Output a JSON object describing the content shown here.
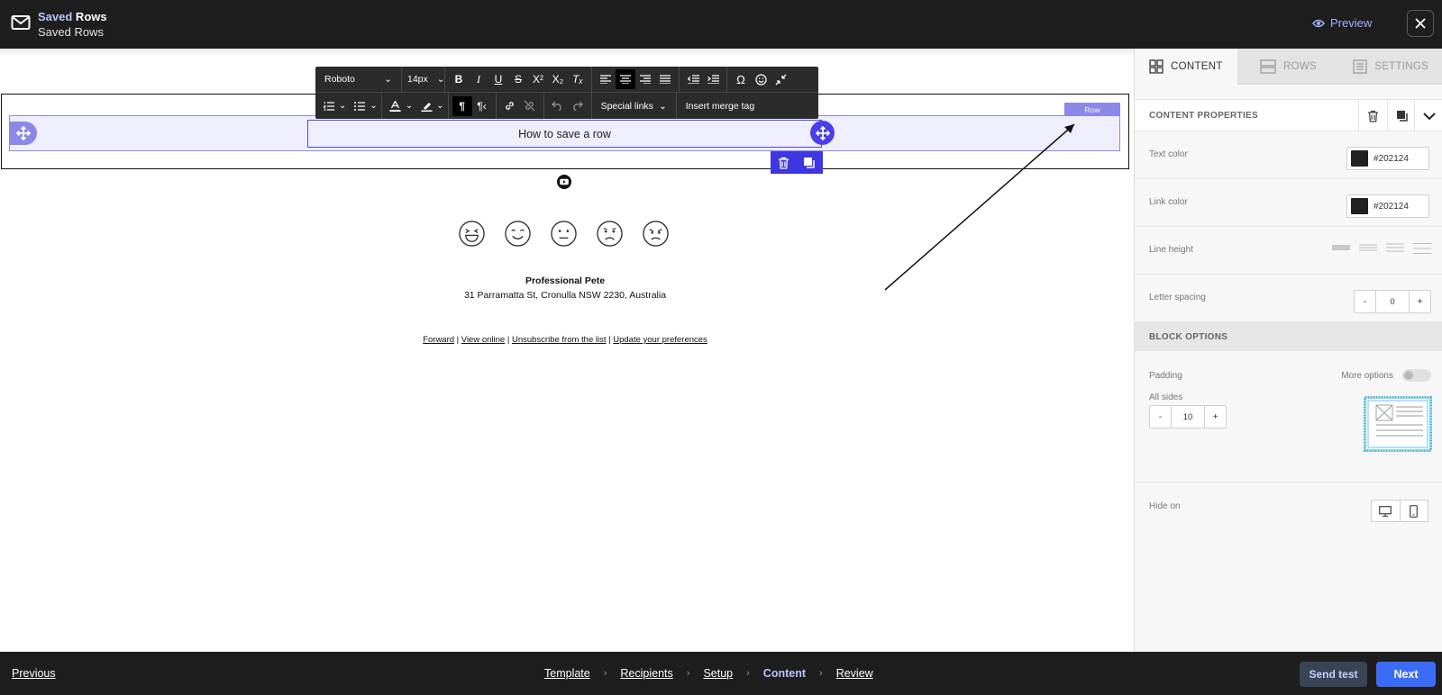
{
  "header": {
    "title_highlight": "Saved",
    "title_rest": " Rows",
    "subtitle": "Saved Rows",
    "preview_label": "Preview"
  },
  "editor": {
    "font_family": "Roboto",
    "font_size": "14px",
    "special_links_label": "Special links",
    "merge_tag_label": "Insert merge tag",
    "row_tag": "Row",
    "text_block": "How to save a row"
  },
  "email": {
    "contact_name": "Professional Pete",
    "contact_address": "31 Parramatta St, Cronulla NSW 2230, Australia",
    "footer_links": [
      "Forward",
      "View online",
      "Unsubscribe from the list",
      "Update your preferences"
    ],
    "footer_sep": " | "
  },
  "panel": {
    "tabs": [
      {
        "label": "CONTENT",
        "icon": "content-grid-icon",
        "active": true
      },
      {
        "label": "ROWS",
        "icon": "rows-icon",
        "active": false
      },
      {
        "label": "SETTINGS",
        "icon": "settings-list-icon",
        "active": false
      }
    ],
    "content_properties_title": "CONTENT PROPERTIES",
    "text_color_label": "Text color",
    "text_color_value": "#202124",
    "link_color_label": "Link color",
    "link_color_value": "#202124",
    "line_height_label": "Line height",
    "letter_spacing_label": "Letter spacing",
    "letter_spacing_value": "0",
    "block_options_title": "BLOCK OPTIONS",
    "padding_label": "Padding",
    "more_options_label": "More options",
    "all_sides_label": "All sides",
    "padding_value": "10",
    "hide_on_label": "Hide on",
    "minus": "-",
    "plus": "+"
  },
  "footer": {
    "previous_label": "Previous",
    "steps": [
      "Template",
      "Recipients",
      "Setup",
      "Content",
      "Review"
    ],
    "current_step": "Content",
    "send_test_label": "Send test",
    "next_label": "Next"
  },
  "colors": {
    "accent": "#4a3fe8",
    "row_highlight": "#8c88e8",
    "next_button": "#3c6cf7",
    "text_color": "#202124"
  }
}
